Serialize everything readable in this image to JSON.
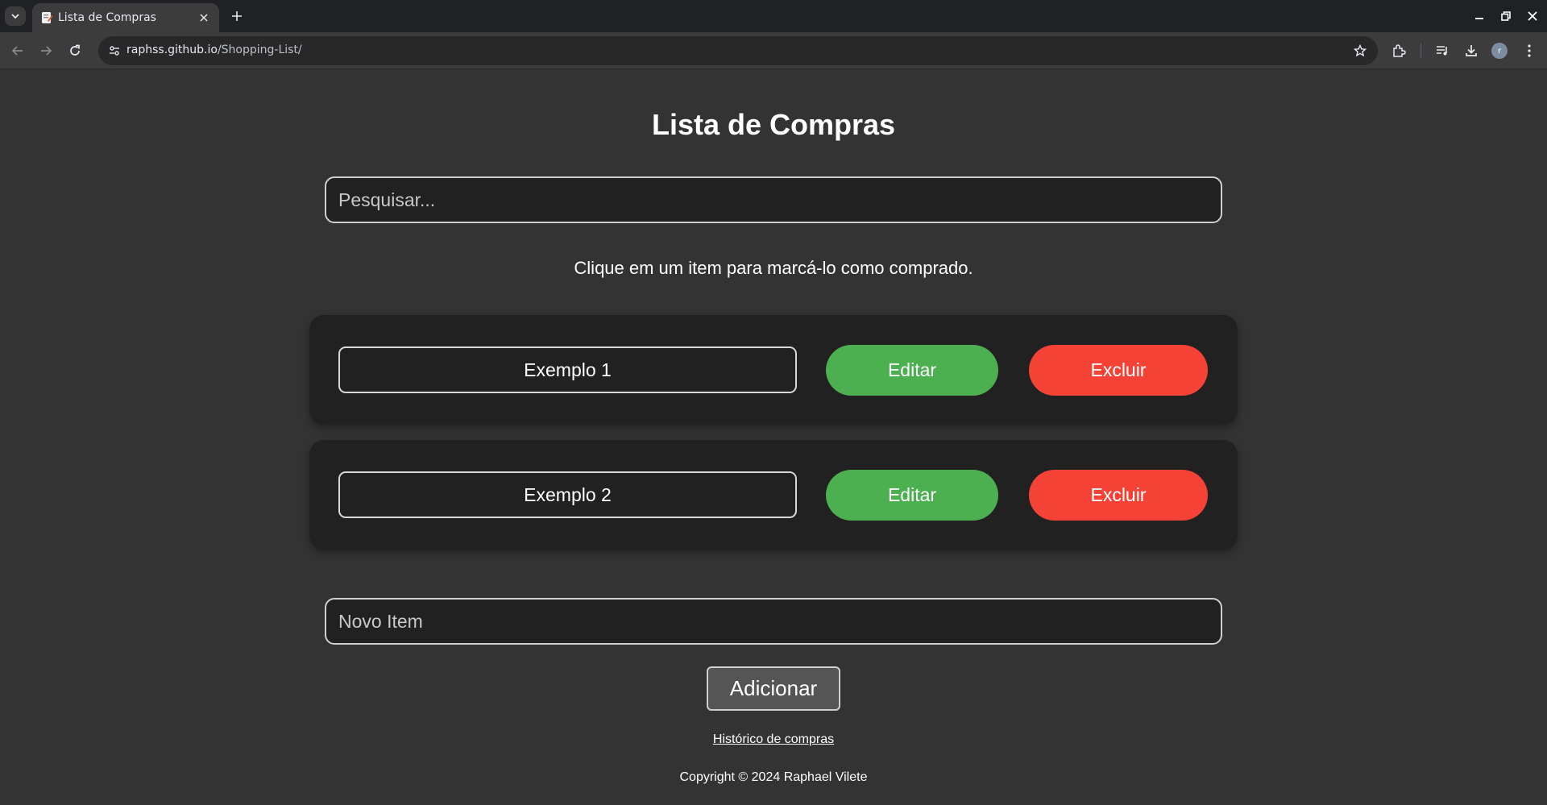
{
  "browser": {
    "tab_title": "Lista de Compras",
    "url_host": "raphss.github.io",
    "url_path": "/Shopping-List/",
    "avatar_letter": "r",
    "icons": [
      "tab-search-icon",
      "favicon-icon",
      "close-icon",
      "plus-icon",
      "minimize-icon",
      "restore-icon",
      "close-window-icon",
      "back-icon",
      "forward-icon",
      "reload-icon",
      "site-info-icon",
      "star-icon",
      "extensions-icon",
      "media-icon",
      "download-icon",
      "menu-icon"
    ]
  },
  "page": {
    "title": "Lista de Compras",
    "search_placeholder": "Pesquisar...",
    "hint": "Clique em um item para marcá-lo como comprado.",
    "items": [
      {
        "name": "Exemplo 1",
        "edit_label": "Editar",
        "delete_label": "Excluir"
      },
      {
        "name": "Exemplo 2",
        "edit_label": "Editar",
        "delete_label": "Excluir"
      }
    ],
    "new_item_placeholder": "Novo Item",
    "add_label": "Adicionar",
    "history_link": "Histórico de compras",
    "copyright": "Copyright © 2024 Raphael Vilete"
  },
  "colors": {
    "background": "#333333",
    "card": "#212121",
    "edit": "#4caf50",
    "delete": "#f44336",
    "add_button": "#555555"
  }
}
